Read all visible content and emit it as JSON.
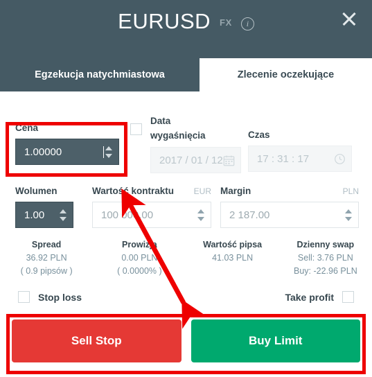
{
  "header": {
    "symbol": "EURUSD",
    "badge": "FX",
    "info_icon": "info-circle-icon",
    "close_icon": "close-icon",
    "background": "#455a64"
  },
  "tabs": [
    {
      "label": "Egzekucja natychmiastowa",
      "active": false
    },
    {
      "label": "Zlecenie oczekujące",
      "active": true
    }
  ],
  "price": {
    "label": "Cena",
    "value": "1.00000",
    "focused": true
  },
  "expiry": {
    "label_line1": "Data",
    "label_line2": "wygaśnięcia",
    "checked": false,
    "date_value": "2017 / 01 / 12",
    "icon": "calendar-icon"
  },
  "time": {
    "label": "Czas",
    "value": "17 : 31 : 17",
    "icon": "clock-icon"
  },
  "volume": {
    "label": "Wolumen",
    "value": "1.00"
  },
  "contract_value": {
    "label": "Wartość kontraktu",
    "unit": "EUR",
    "value": "100 000.00"
  },
  "margin": {
    "label": "Margin",
    "unit": "PLN",
    "value": "2 187.00"
  },
  "stats": [
    {
      "title": "Spread",
      "line1": "36.92 PLN",
      "line2": "( 0.9 pipsów )"
    },
    {
      "title": "Prowizja",
      "line1": "0.00 PLN",
      "line2": "( 0.0000% )"
    },
    {
      "title": "Wartość pipsa",
      "line1": "41.03 PLN",
      "line2": ""
    },
    {
      "title": "Dzienny swap",
      "line1": "Sell: 3.76 PLN",
      "line2": "Buy: -22.96 PLN"
    }
  ],
  "stop_loss": {
    "label": "Stop loss",
    "checked": false
  },
  "take_profit": {
    "label": "Take profit",
    "checked": false
  },
  "buttons": {
    "sell": {
      "label": "Sell Stop",
      "color": "#e53935"
    },
    "buy": {
      "label": "Buy Limit",
      "color": "#00a96e"
    }
  },
  "annotations": {
    "color": "#ee0000",
    "highlight_price_field": true,
    "highlight_action_buttons": true,
    "arrow": "double-headed-arrow-from-contract-value-to-buttons"
  }
}
